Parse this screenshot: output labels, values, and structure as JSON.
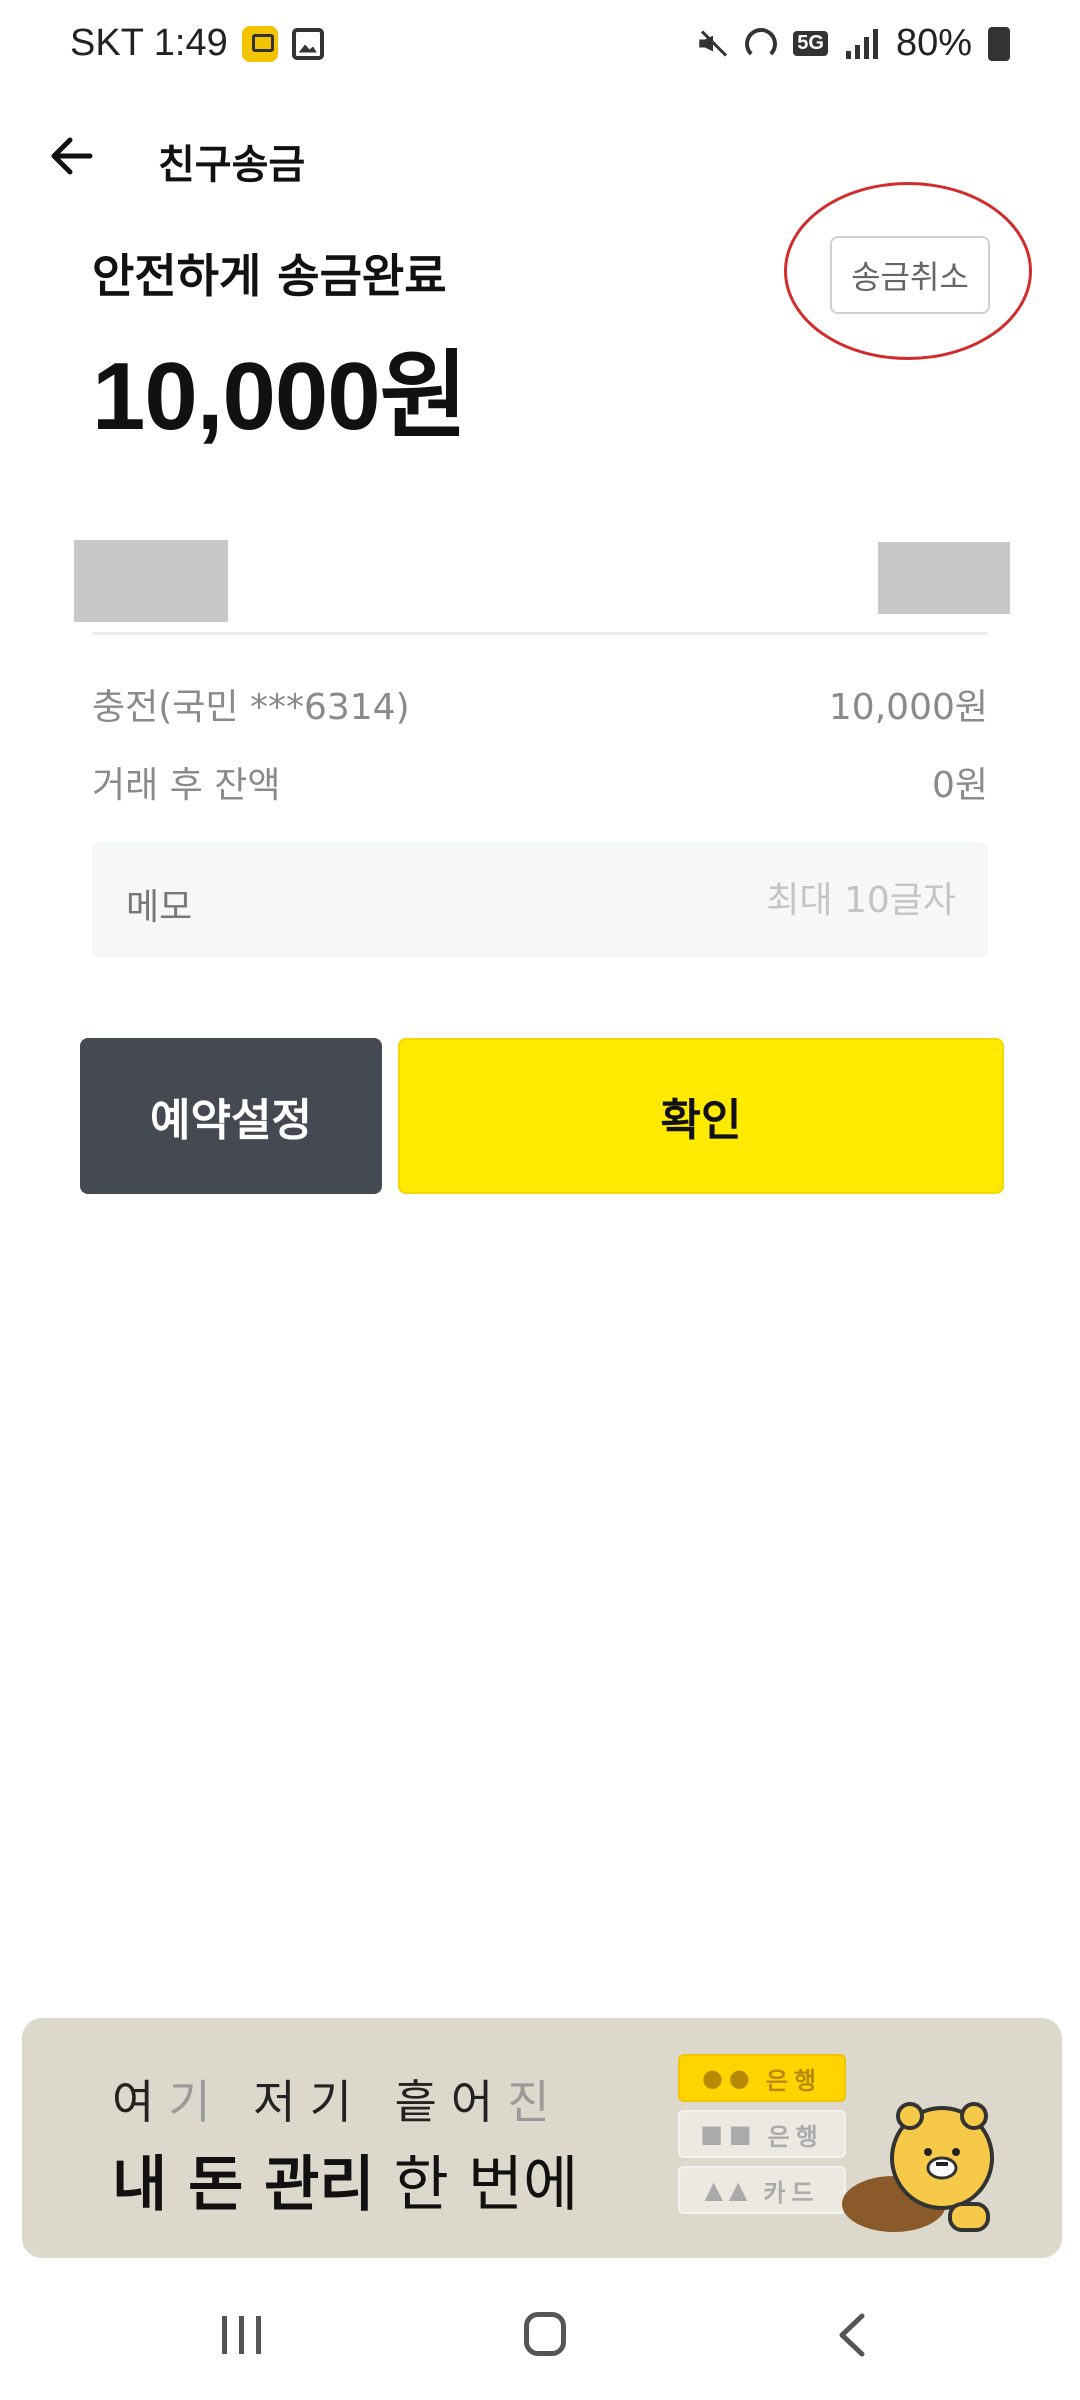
{
  "status_bar": {
    "carrier_time": "SKT 1:49",
    "network": "5G",
    "battery": "80%",
    "icons": [
      "kb-app-icon",
      "gallery-icon",
      "mute-icon",
      "hotspot-icon",
      "5g-icon",
      "signal-icon",
      "battery-icon"
    ]
  },
  "header": {
    "title": "친구송금",
    "back_icon": "arrow-left-icon"
  },
  "transfer": {
    "status_text": "안전하게 송금완료",
    "amount": "10,000원",
    "cancel_label": "송금취소"
  },
  "details": [
    {
      "label": "충전(국민 ***6314)",
      "value": "10,000원"
    },
    {
      "label": "거래 후 잔액",
      "value": "0원"
    }
  ],
  "memo": {
    "label": "메모",
    "placeholder": "최대 10글자"
  },
  "buttons": {
    "reserve_label": "예약설정",
    "confirm_label": "확인"
  },
  "banner": {
    "line1_dark_a": "여",
    "line1_faded_a": "기",
    "line1_dark_b": "저기",
    "line1_dark_c": "흩어",
    "line1_faded_b": "진",
    "line2_bold": "내 돈 관리",
    "line2_regular": " 한 번에",
    "chip1": "은행",
    "chip2": "은행",
    "chip3": "카드"
  },
  "colors": {
    "confirm_yellow": "#ffea00",
    "reserve_dark": "#454a52",
    "annotation_red": "#d22b2b",
    "banner_bg": "#ddd8cc"
  }
}
